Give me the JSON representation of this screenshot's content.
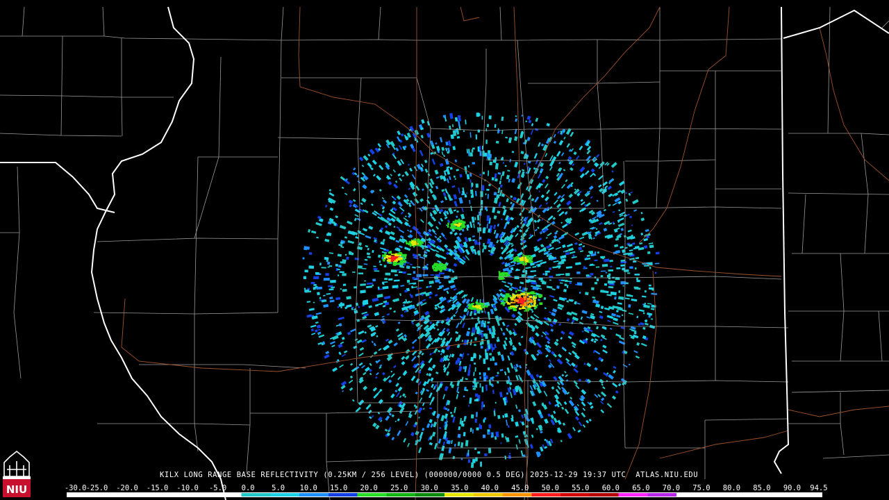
{
  "caption": "KILX LONG RANGE BASE REFLECTIVITY (0.25KM / 256 LEVEL) (000000/0000 0.5 DEG) 2025-12-29 19:37 UTC  ATLAS.NIU.EDU",
  "scale": {
    "labels": [
      "-30.0",
      "-25.0",
      "-20.0",
      "-15.0",
      "-10.0",
      "-5.0",
      "0.0",
      "5.0",
      "10.0",
      "15.0",
      "20.0",
      "25.0",
      "30.0",
      "35.0",
      "40.0",
      "45.0",
      "50.0",
      "55.0",
      "60.0",
      "65.0",
      "70.0",
      "75.0",
      "80.0",
      "85.0",
      "90.0",
      "94.5"
    ],
    "colors": [
      "#ffffff",
      "#ffffff",
      "#ffffff",
      "#ffffff",
      "#ffffff",
      "#ffffff",
      "#22c8c8",
      "#1ed2e6",
      "#1e90ff",
      "#1440e6",
      "#28dc28",
      "#14b414",
      "#0a8c0a",
      "#e6e600",
      "#f0c800",
      "#ff9600",
      "#ff1e1e",
      "#d20000",
      "#b40000",
      "#ff28ff",
      "#b428e6",
      "#ffffff",
      "#ffffff",
      "#ffffff",
      "#ffffff",
      "#ffffff"
    ]
  },
  "logo": {
    "text": "NIU",
    "color": "#c8102e"
  },
  "map_colors": {
    "background": "#000000",
    "county": "#9a9a9a",
    "state": "#ffffff",
    "highway": "#a0522d"
  }
}
